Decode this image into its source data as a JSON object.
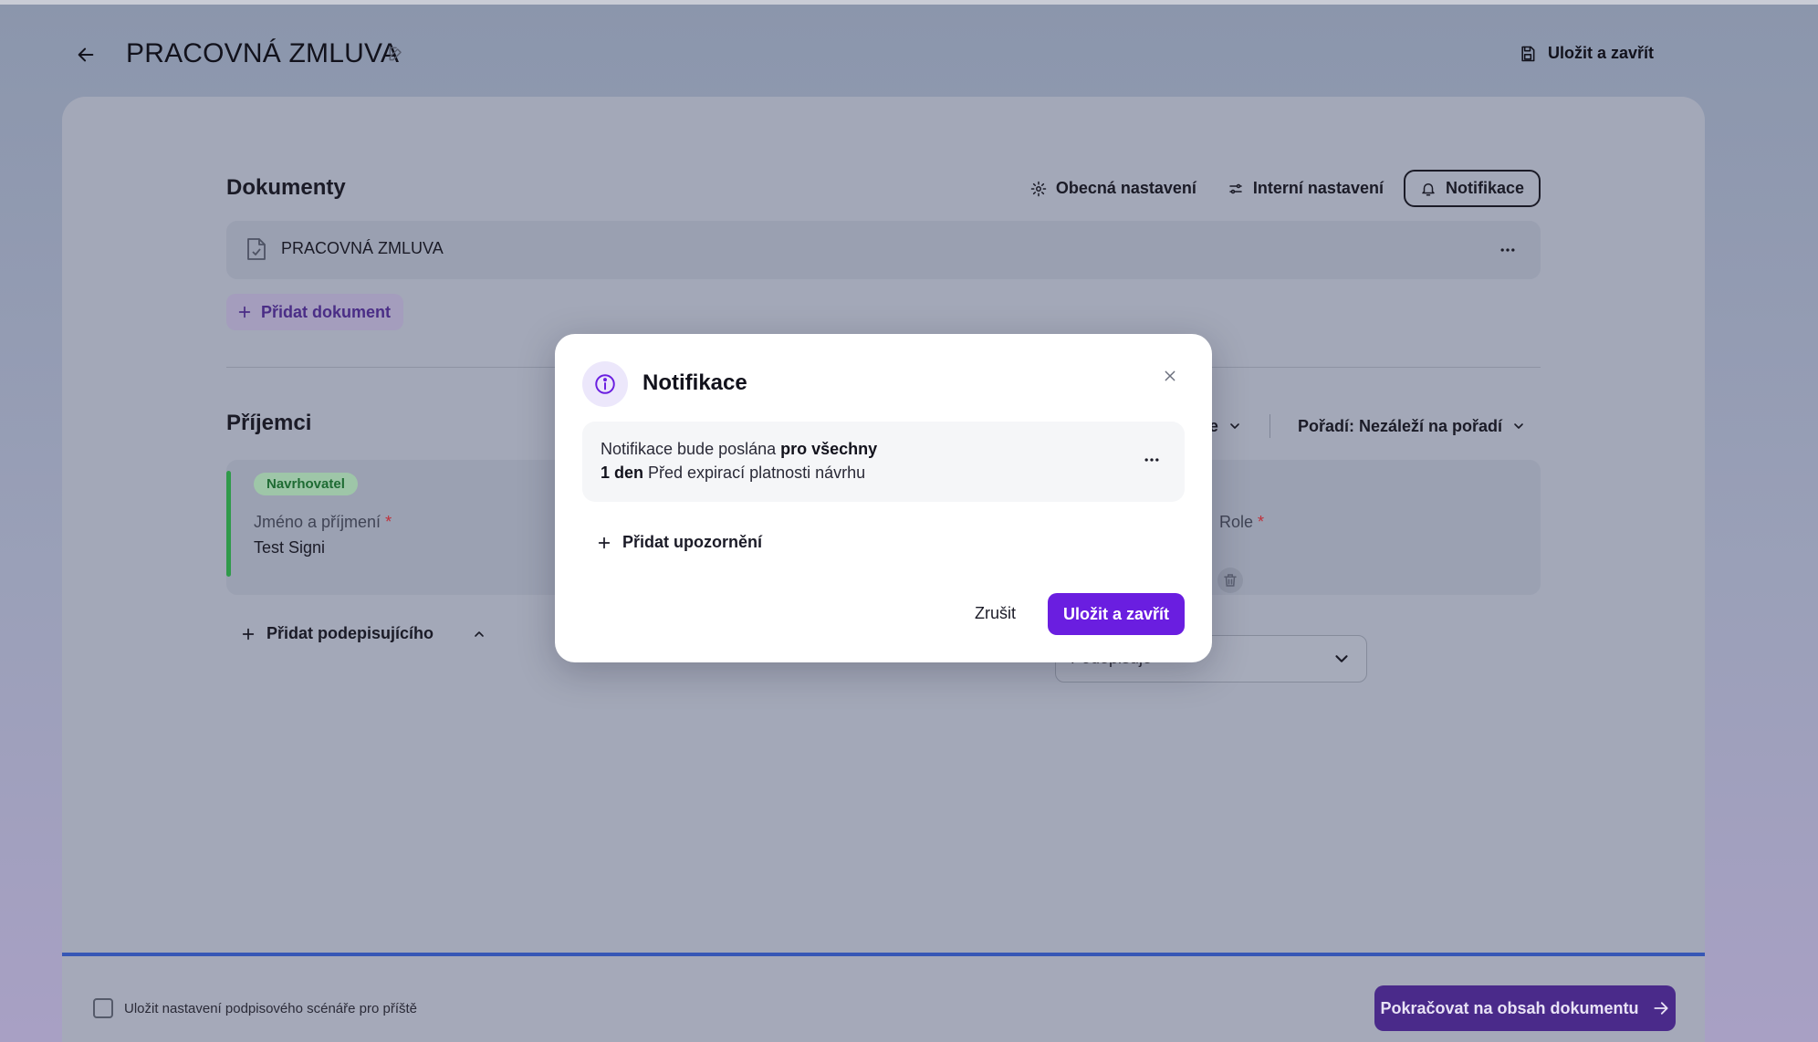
{
  "header": {
    "title": "PRACOVNÁ ZMLUVA",
    "save_close": "Uložit a zavřít"
  },
  "documents": {
    "section_title": "Dokumenty",
    "tabs": [
      {
        "label": "Obecná nastavení",
        "icon": "gear-icon"
      },
      {
        "label": "Interní nastavení",
        "icon": "sliders-icon"
      },
      {
        "label": "Notifikace",
        "icon": "bell-icon",
        "active": true
      }
    ],
    "items": [
      {
        "name": "PRACOVNÁ ZMLUVA"
      }
    ],
    "add_label": "Přidat dokument"
  },
  "recipients": {
    "section_title": "Příjemci",
    "scenario_partial": "áře",
    "order_label": "Pořadí: Nezáleží na pořadí",
    "card": {
      "badge": "Navrhovatel",
      "name_label": "Jméno a příjmení",
      "name_value": "Test Signi",
      "role_label": "Role",
      "role_value": "Podepisuje"
    },
    "add_signer": "Přidat podepisujícího"
  },
  "footer": {
    "checkbox_label": "Uložit nastavení podpisového scénáře pro příště",
    "continue_label": "Pokračovat na obsah dokumentu"
  },
  "modal": {
    "title": "Notifikace",
    "notification": {
      "line1_prefix": "Notifikace bude poslána ",
      "line1_bold": "pro všechny",
      "line2_bold": "1 den",
      "line2_suffix": " Před expirací platnosti návrhu"
    },
    "add_alert": "Přidat upozornění",
    "cancel": "Zrušit",
    "save": "Uložit a zavřít"
  },
  "colors": {
    "accent": "#6a1ee0",
    "proposer_green": "#2f9a4a",
    "continue_btn": "#4a2a8a"
  }
}
